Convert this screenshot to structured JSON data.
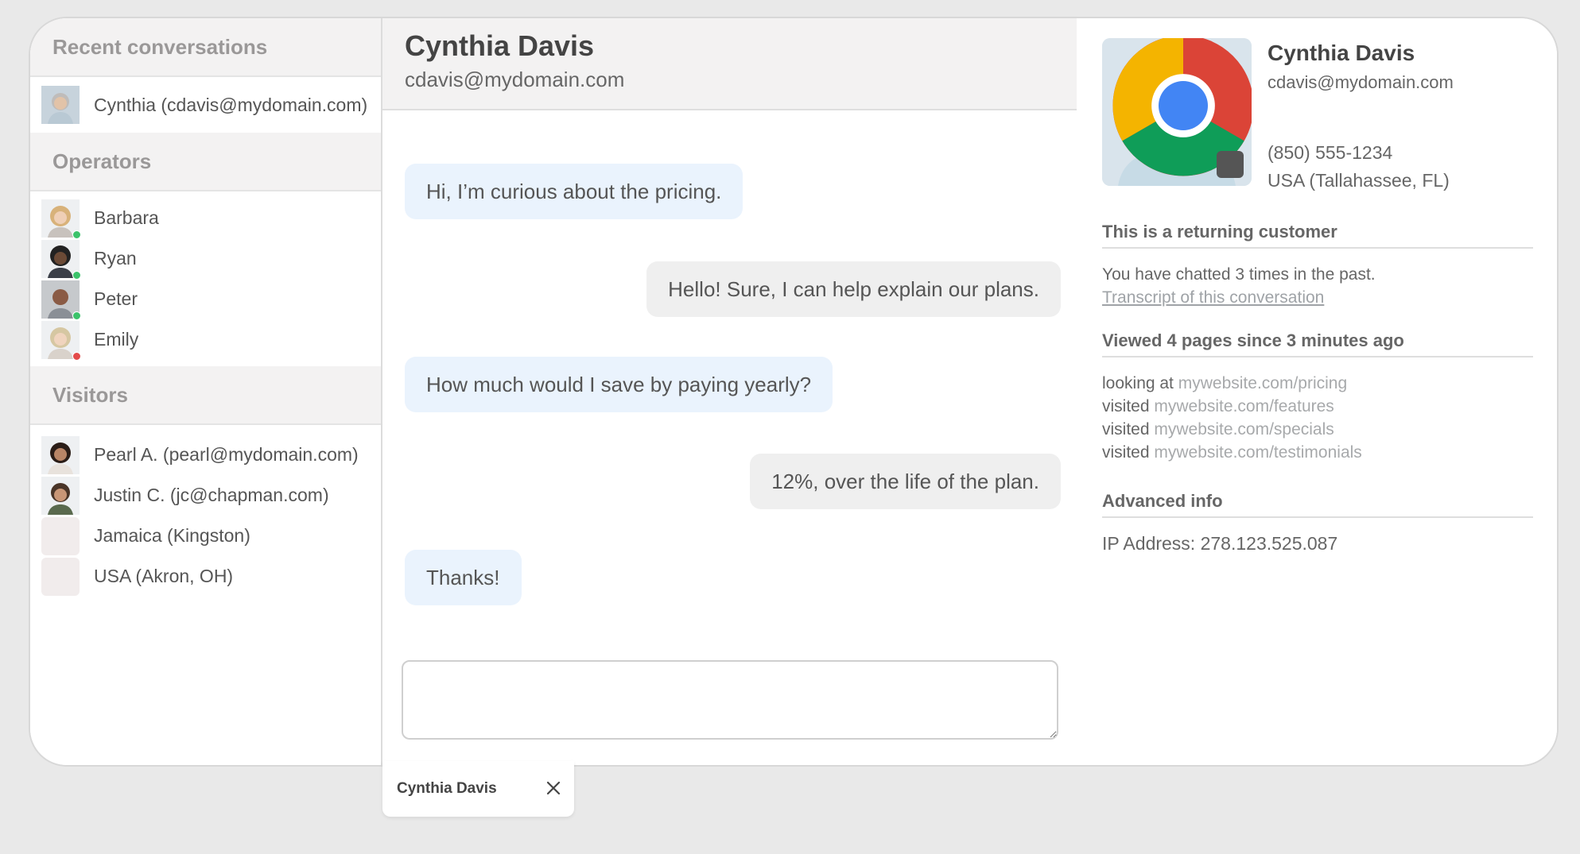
{
  "sidebar": {
    "recent_title": "Recent conversations",
    "recent": [
      {
        "label": "Cynthia (cdavis@mydomain.com)"
      }
    ],
    "operators_title": "Operators",
    "operators": [
      {
        "name": "Barbara",
        "status": "online"
      },
      {
        "name": "Ryan",
        "status": "online"
      },
      {
        "name": "Peter",
        "status": "online"
      },
      {
        "name": "Emily",
        "status": "busy"
      }
    ],
    "visitors_title": "Visitors",
    "visitors": [
      {
        "label": "Pearl A. (pearl@mydomain.com)"
      },
      {
        "label": "Justin C. (jc@chapman.com)"
      },
      {
        "label": "Jamaica (Kingston)"
      },
      {
        "label": "USA (Akron, OH)"
      }
    ]
  },
  "chat": {
    "name": "Cynthia Davis",
    "email": "cdavis@mydomain.com",
    "messages": [
      {
        "from": "visitor",
        "text": "Hi, I’m curious about the pricing."
      },
      {
        "from": "operator",
        "text": "Hello! Sure, I can help explain our plans."
      },
      {
        "from": "visitor",
        "text": "How much would I save by paying yearly?"
      },
      {
        "from": "operator",
        "text": "12%, over the life of the plan."
      },
      {
        "from": "visitor",
        "text": "Thanks!"
      }
    ],
    "composer_value": ""
  },
  "info": {
    "name": "Cynthia Davis",
    "email": "cdavis@mydomain.com",
    "phone": "(850) 555-1234",
    "location": "USA (Tallahassee, FL)",
    "browser_icon": "chrome-icon",
    "os_icon": "apple-icon",
    "returning_title": "This is a returning customer",
    "returning_text": "You have chatted 3 times in the past.",
    "transcript_link": "Transcript of this conversation",
    "viewed_title": "Viewed 4 pages since 3 minutes ago",
    "pages": [
      {
        "verb": "looking at",
        "url": "mywebsite.com/pricing"
      },
      {
        "verb": "visited",
        "url": "mywebsite.com/features"
      },
      {
        "verb": "visited",
        "url": "mywebsite.com/specials"
      },
      {
        "verb": "visited",
        "url": "mywebsite.com/testimonials"
      }
    ],
    "advanced_title": "Advanced info",
    "ip": "IP Address: 278.123.525.087"
  },
  "tab": {
    "label": "Cynthia Davis",
    "close_icon": "close-icon"
  },
  "colors": {
    "visitor_bubble": "#eaf3fd",
    "operator_bubble": "#efefef",
    "online": "#3cc36b",
    "busy": "#e34a4a"
  }
}
